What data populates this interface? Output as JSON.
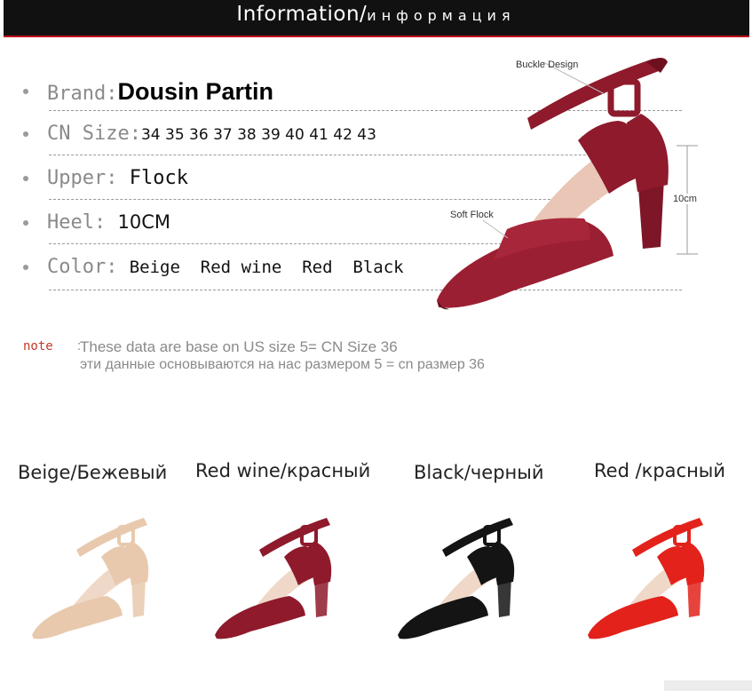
{
  "header": {
    "title_en": "Information/",
    "title_ru": "информация"
  },
  "specs": {
    "brand": {
      "label": "Brand:",
      "value": "Dousin Partin"
    },
    "size": {
      "label": "CN Size:",
      "value": "34 35 36 37 38 39 40 41 42 43"
    },
    "upper": {
      "label": "Upper:",
      "value": "Flock"
    },
    "heel": {
      "label": "Heel:",
      "value": "10CM"
    },
    "color": {
      "label": "Color:",
      "value": "Beige  Red wine  Red  Black"
    }
  },
  "hero": {
    "callout_buckle": "Buckle Design",
    "callout_flock": "Soft Flock",
    "callout_height": "10cm"
  },
  "note": {
    "label": "note",
    "colon": ":",
    "text_en": "These data are base on US size 5= CN Size 36",
    "text_ru": "эти данные основываются на нас размером 5 = cn размер 36"
  },
  "variants": [
    {
      "label": "Beige/Бежевый",
      "color": "#e8c9ad"
    },
    {
      "label": "Red wine/красный",
      "color": "#8e1a2c"
    },
    {
      "label": "Black/черный",
      "color": "#141414"
    },
    {
      "label": "Red /красный",
      "color": "#e3221b"
    }
  ],
  "colors": {
    "hero": "#9b1f32",
    "accent": "#c00f1c"
  }
}
